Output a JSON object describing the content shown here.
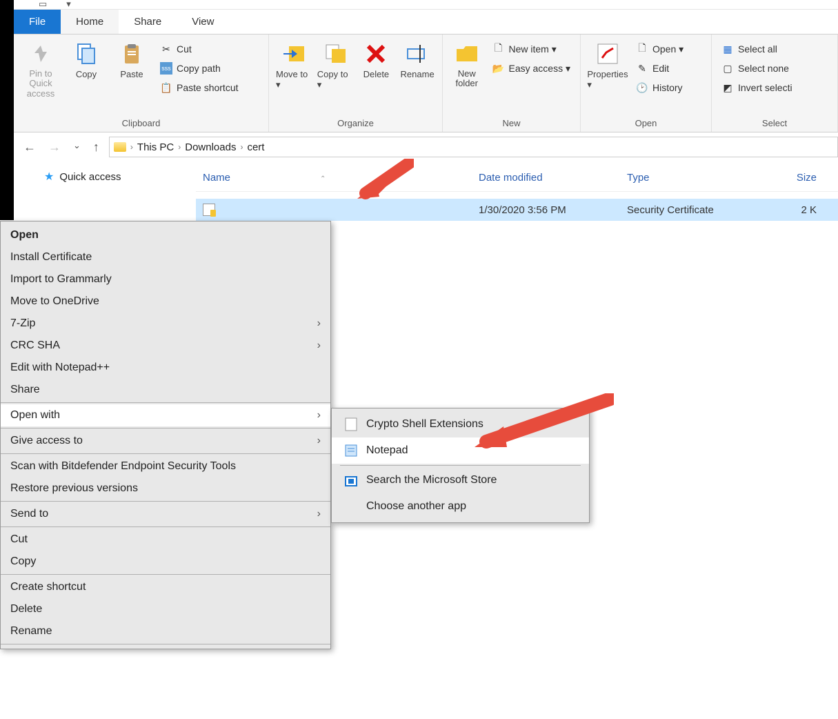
{
  "tabs": {
    "file": "File",
    "home": "Home",
    "share": "Share",
    "view": "View"
  },
  "ribbon": {
    "clipboard": {
      "label": "Clipboard",
      "pin": "Pin to Quick access",
      "copy": "Copy",
      "paste": "Paste",
      "cut": "Cut",
      "copy_path": "Copy path",
      "paste_shortcut": "Paste shortcut"
    },
    "organize": {
      "label": "Organize",
      "move_to": "Move to",
      "copy_to": "Copy to",
      "delete": "Delete",
      "rename": "Rename"
    },
    "new": {
      "label": "New",
      "new_folder": "New folder",
      "new_item": "New item",
      "easy_access": "Easy access"
    },
    "open": {
      "label": "Open",
      "properties": "Properties",
      "open": "Open",
      "edit": "Edit",
      "history": "History"
    },
    "select": {
      "label": "Select",
      "select_all": "Select all",
      "select_none": "Select none",
      "invert": "Invert selecti"
    }
  },
  "breadcrumb": [
    "This PC",
    "Downloads",
    "cert"
  ],
  "nav_pane": {
    "quick_access": "Quick access"
  },
  "columns": {
    "name": "Name",
    "date": "Date modified",
    "type": "Type",
    "size": "Size"
  },
  "file": {
    "name": "",
    "date": "1/30/2020 3:56 PM",
    "type": "Security Certificate",
    "size": "2 K"
  },
  "context_menu": {
    "open": "Open",
    "install_cert": "Install Certificate",
    "import_grammarly": "Import to Grammarly",
    "move_onedrive": "Move to OneDrive",
    "seven_zip": "7-Zip",
    "crc_sha": "CRC SHA",
    "edit_npp": "Edit with Notepad++",
    "share": "Share",
    "open_with": "Open with",
    "give_access": "Give access to",
    "scan_bitdefender": "Scan with Bitdefender Endpoint Security Tools",
    "restore_prev": "Restore previous versions",
    "send_to": "Send to",
    "cut": "Cut",
    "copy": "Copy",
    "create_shortcut": "Create shortcut",
    "delete": "Delete",
    "rename": "Rename"
  },
  "sub_menu": {
    "crypto": "Crypto Shell Extensions",
    "notepad": "Notepad",
    "search_store": "Search the Microsoft Store",
    "choose": "Choose another app"
  }
}
